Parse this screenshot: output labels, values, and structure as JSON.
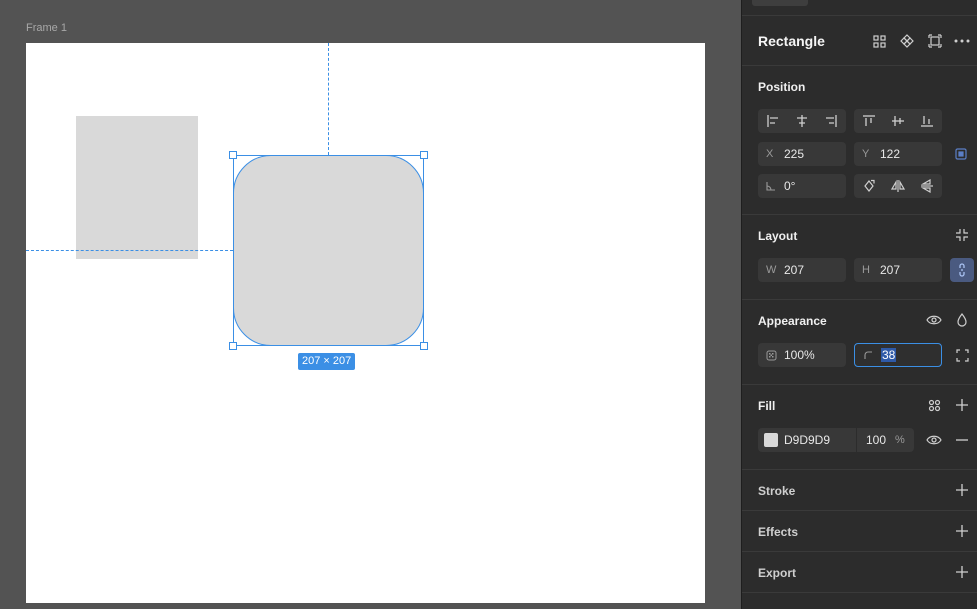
{
  "canvas": {
    "frame_label": "Frame 1",
    "size_badge": "207 × 207",
    "fill_color": "#d9d9d9",
    "selection_color": "#3b8fe5"
  },
  "panel": {
    "title": "Rectangle",
    "title_icons": [
      "grid-icon",
      "component-icon",
      "frame-icon",
      "more-icon"
    ],
    "position": {
      "title": "Position",
      "x_label": "X",
      "x_value": "225",
      "y_label": "Y",
      "y_value": "122",
      "rotation_value": "0°"
    },
    "layout": {
      "title": "Layout",
      "w_label": "W",
      "w_value": "207",
      "h_label": "H",
      "h_value": "207"
    },
    "appearance": {
      "title": "Appearance",
      "opacity_value": "100%",
      "radius_value": "38"
    },
    "fill": {
      "title": "Fill",
      "hex": "D9D9D9",
      "opacity": "100",
      "percent": "%",
      "swatch": "#d9d9d9"
    },
    "stroke": {
      "title": "Stroke"
    },
    "effects": {
      "title": "Effects"
    },
    "export": {
      "title": "Export"
    }
  }
}
